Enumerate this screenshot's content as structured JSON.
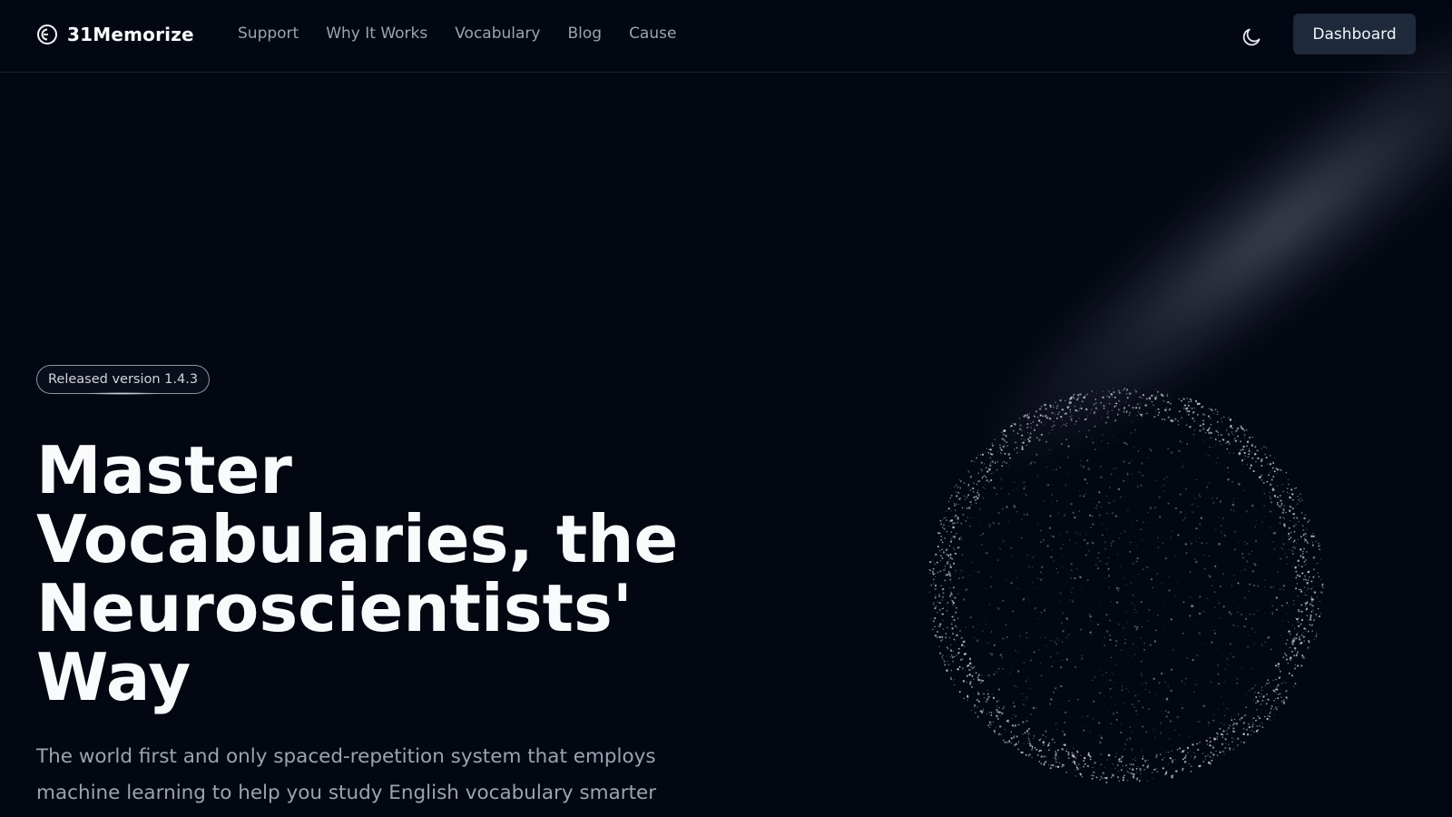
{
  "header": {
    "brand": {
      "name": "31Memorize",
      "icon": "brand-logo-icon"
    },
    "nav_links": [
      {
        "label": "Support"
      },
      {
        "label": "Why It Works"
      },
      {
        "label": "Vocabulary"
      },
      {
        "label": "Blog"
      },
      {
        "label": "Cause"
      }
    ],
    "theme_toggle": {
      "icon": "moon-icon"
    },
    "dashboard_label": "Dashboard"
  },
  "hero": {
    "version_badge": "Released version 1.4.3",
    "title_lines": [
      "Master",
      "Vocabularies, the",
      "Neuroscientists'",
      "Way"
    ],
    "subtitle_lines": [
      "The world first and only spaced-repetition system that employs",
      "machine learning to help you study English vocabulary smarter"
    ]
  },
  "colors": {
    "background": "#030712",
    "text_primary": "#f9fafb",
    "text_muted": "#9ca3af",
    "button_bg": "#1e293b"
  }
}
